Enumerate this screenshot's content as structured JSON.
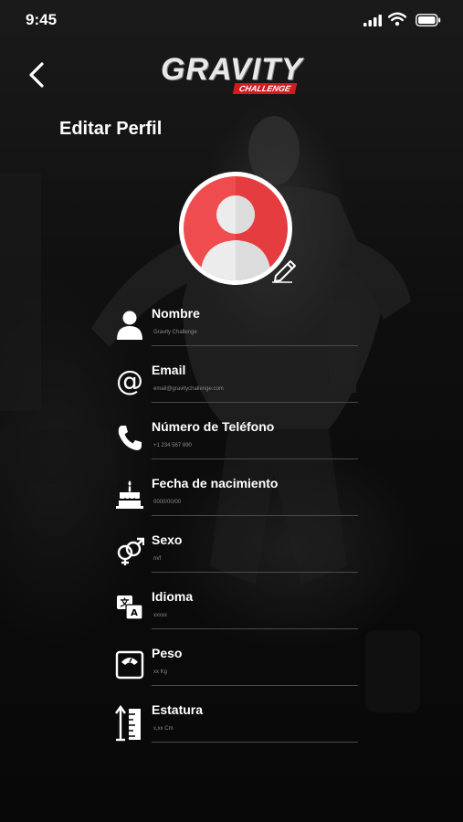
{
  "status_bar": {
    "time": "9:45"
  },
  "header": {
    "logo_main": "GRAVITY",
    "logo_sub": "CHALLENGE",
    "title": "Editar Perfil"
  },
  "colors": {
    "accent": "#d61a1a",
    "avatar_red": "#ef4c4f",
    "avatar_gray": "#e4e4e4"
  },
  "fields": [
    {
      "icon": "person-icon",
      "label": "Nombre",
      "value": "Gravity Challenge"
    },
    {
      "icon": "at-sign-icon",
      "label": "Email",
      "value": "email@gravitychallenge.com"
    },
    {
      "icon": "phone-icon",
      "label": "Número de  Teléfono",
      "value": "+1 234 567 890"
    },
    {
      "icon": "birthday-cake-icon",
      "label": "Fecha de nacimiento",
      "value": "0000/00/00"
    },
    {
      "icon": "gender-icon",
      "label": "Sexo",
      "value": "m/f"
    },
    {
      "icon": "translate-icon",
      "label": "Idioma",
      "value": "xxxxx"
    },
    {
      "icon": "scale-icon",
      "label": "Peso",
      "value": "xx Kg"
    },
    {
      "icon": "height-ruler-icon",
      "label": "Estatura",
      "value": "x,xx Cm"
    }
  ]
}
